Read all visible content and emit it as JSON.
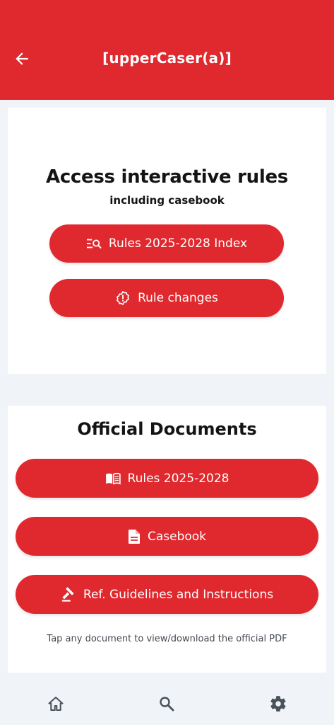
{
  "header": {
    "title": "[upperCaser(a)]",
    "back_icon": "arrow-left-icon",
    "background": "#e0292e"
  },
  "rules_card": {
    "title": "Access interactive rules",
    "subtitle": "including casebook",
    "buttons": [
      {
        "label": "Rules 2025-2028 Index",
        "icon": "list-search-icon"
      },
      {
        "label": "Rule changes",
        "icon": "alert-badge-icon"
      }
    ]
  },
  "docs_card": {
    "title": "Official Documents",
    "buttons": [
      {
        "label": "Rules 2025-2028",
        "icon": "book-icon"
      },
      {
        "label": "Casebook",
        "icon": "document-icon"
      },
      {
        "label": "Ref. Guidelines and Instructions",
        "icon": "gavel-icon"
      }
    ],
    "hint": "Tap any document to view/download the official PDF"
  },
  "bottom_nav": {
    "items": [
      {
        "name": "home",
        "icon": "home-icon"
      },
      {
        "name": "search",
        "icon": "search-icon"
      },
      {
        "name": "settings",
        "icon": "gear-icon"
      }
    ]
  },
  "colors": {
    "accent": "#e0292e",
    "background": "#f0f3f7",
    "card": "#ffffff",
    "text": "#141414"
  }
}
